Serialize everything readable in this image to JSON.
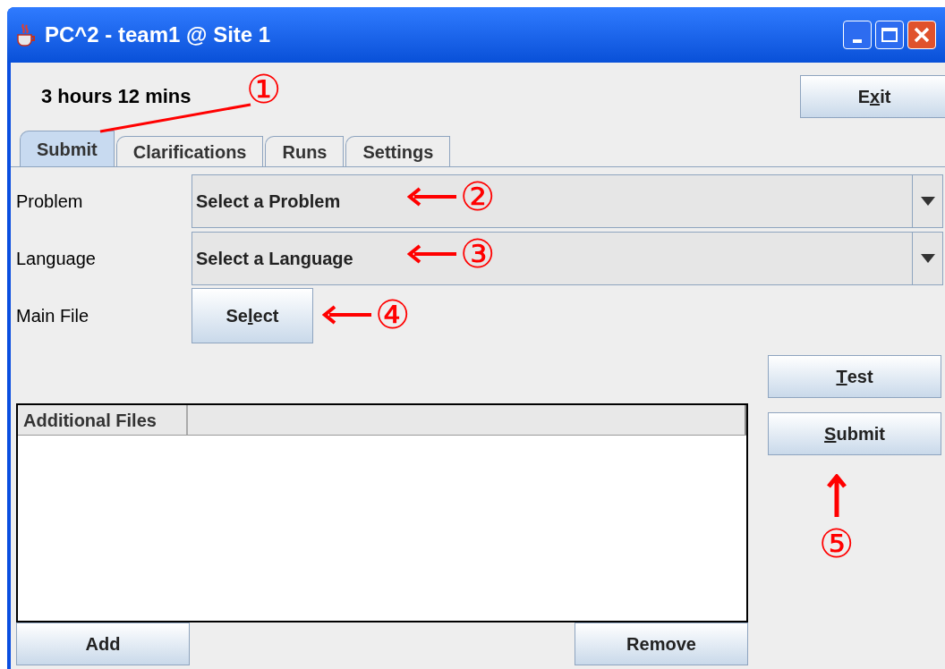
{
  "window": {
    "title": "PC^2 - team1 @ Site 1"
  },
  "time_remaining": "3 hours 12 mins",
  "exit_button": {
    "label": {
      "before": "E",
      "key": "x",
      "after": "it"
    }
  },
  "tabs": [
    {
      "label": "Submit",
      "selected": true
    },
    {
      "label": "Clarifications",
      "selected": false
    },
    {
      "label": "Runs",
      "selected": false
    },
    {
      "label": "Settings",
      "selected": false
    }
  ],
  "form": [
    {
      "label": "Problem",
      "kind": "dropdown",
      "value": "Select a Problem"
    },
    {
      "label": "Language",
      "kind": "dropdown",
      "value": "Select a Language"
    },
    {
      "label": "Main File",
      "kind": "button",
      "value": {
        "before": "Se",
        "key": "l",
        "after": "ect"
      }
    }
  ],
  "side_buttons": [
    {
      "label": {
        "key": "T",
        "after": "est"
      }
    },
    {
      "label": {
        "key": "S",
        "after": "ubmit"
      }
    }
  ],
  "additional_files": {
    "columns": [
      "Additional Files"
    ],
    "buttons": [
      "Add",
      "Remove"
    ]
  },
  "annotations": [
    {
      "label": "①",
      "kind": "line"
    },
    {
      "label": "②",
      "kind": "left"
    },
    {
      "label": "③",
      "kind": "left"
    },
    {
      "label": "④",
      "kind": "left"
    },
    {
      "label": "⑤",
      "kind": "up"
    }
  ]
}
